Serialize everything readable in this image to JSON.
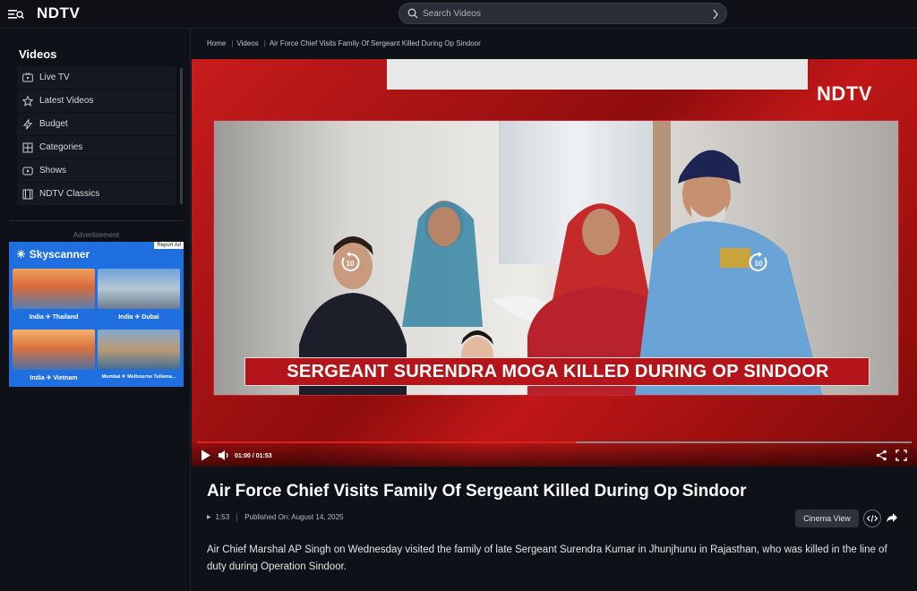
{
  "header": {
    "logo_main": "NDTV",
    "search_placeholder": "Search Videos"
  },
  "sidebar": {
    "title": "Videos",
    "items": [
      {
        "label": "Live TV",
        "icon": "tv-icon"
      },
      {
        "label": "Latest Videos",
        "icon": "star-icon"
      },
      {
        "label": "Budget",
        "icon": "bolt-icon"
      },
      {
        "label": "Categories",
        "icon": "grid-icon"
      },
      {
        "label": "Shows",
        "icon": "play-box-icon"
      },
      {
        "label": "NDTV Classics",
        "icon": "film-icon"
      }
    ],
    "ad_label": "Advertisement",
    "ad": {
      "report": "Report Ad",
      "brand": "Skyscanner",
      "tiles": [
        "India ✈ Thailand",
        "India ✈ Dubai",
        "India ✈ Vietnam",
        "Mumbai ✈ Melbourne Tullama..."
      ]
    }
  },
  "breadcrumb": {
    "items": [
      "Home",
      "Videos",
      "Air Force Chief Visits Family Of Sergeant Killed During Op Sindoor"
    ]
  },
  "player": {
    "channel_logo": "NDTV",
    "caption": "SERGEANT SURENDRA MOGA KILLED DURING OP SINDOOR",
    "skip_back": "10",
    "skip_forward": "10",
    "time": "01:00 / 01:53",
    "progress": 0.53
  },
  "video": {
    "title": "Air Force Chief Visits Family Of Sergeant Killed During Op Sindoor",
    "duration": "1:53",
    "published": "Published On: August 14, 2025",
    "cinema_label": "Cinema View",
    "description": "Air Chief Marshal AP Singh on Wednesday visited the family of late Sergeant Surendra Kumar in Jhunjhunu in Rajasthan, who was killed in the line of duty during Operation Sindoor."
  },
  "colors": {
    "accent": "#e02020",
    "background": "#0f1118",
    "ad_blue": "#1f6fe0"
  }
}
